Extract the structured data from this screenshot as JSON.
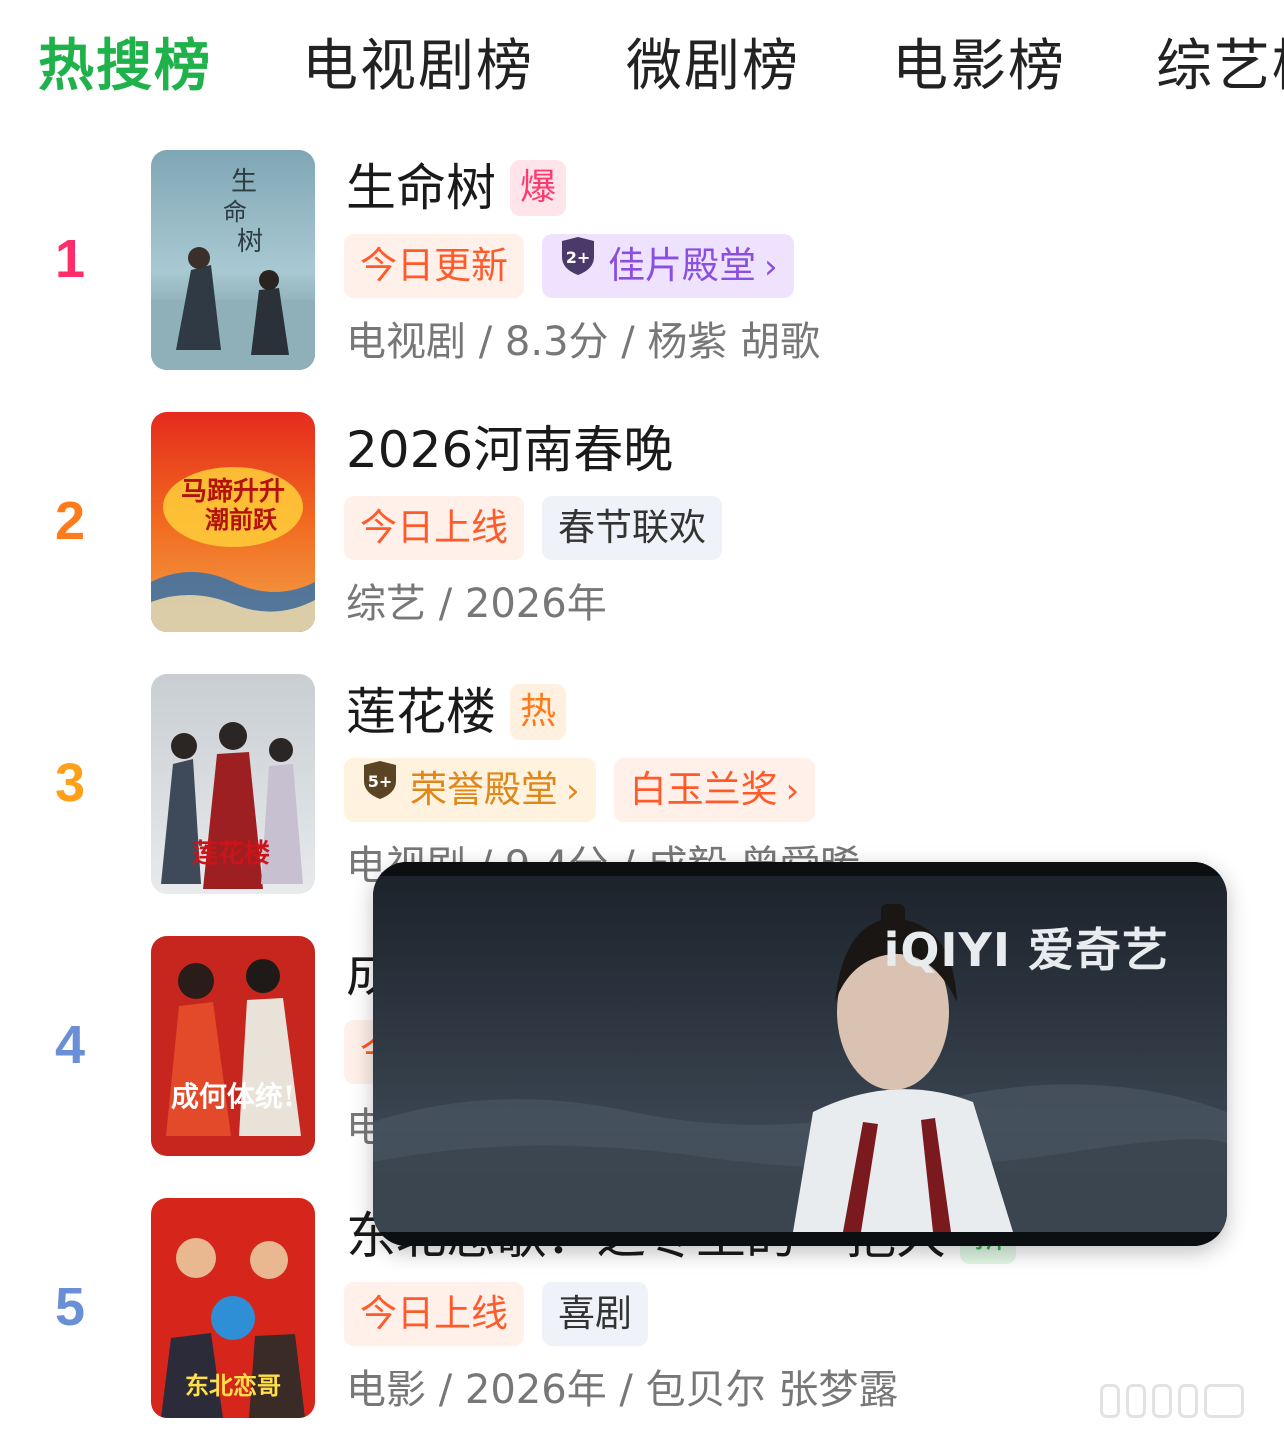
{
  "tabs": [
    {
      "label": "热搜榜",
      "active": true
    },
    {
      "label": "电视剧榜",
      "active": false
    },
    {
      "label": "微剧榜",
      "active": false
    },
    {
      "label": "电影榜",
      "active": false
    },
    {
      "label": "综艺榜",
      "active": false
    }
  ],
  "colors": {
    "accent_green": "#20b24a",
    "rank1": "#ff2d6a",
    "rank2": "#ff7a1a",
    "rank3": "#ff9f1a",
    "rank45": "#6b8fd6"
  },
  "items": [
    {
      "rank": "1",
      "title": "生命树",
      "badge": "爆",
      "tags": [
        "今日更新",
        "佳片殿堂"
      ],
      "tag_icon": "2+",
      "meta": "电视剧 / 8.3分 / 杨紫 胡歌"
    },
    {
      "rank": "2",
      "title": "2026河南春晚",
      "badge": "",
      "tags": [
        "今日上线",
        "春节联欢"
      ],
      "meta": "综艺 / 2026年"
    },
    {
      "rank": "3",
      "title": "莲花楼",
      "badge": "热",
      "tags": [
        "荣誉殿堂",
        "白玉兰奖"
      ],
      "tag_icon": "5+",
      "meta": "电视剧 / 9.4分 / 成毅 曾舜晞"
    },
    {
      "rank": "4",
      "title": "成",
      "badge": "",
      "tags": [
        "今"
      ],
      "meta": "电"
    },
    {
      "rank": "5",
      "title": "东北恋歌：之冬至的一抱大",
      "badge": "新",
      "tags": [
        "今日上线",
        "喜剧"
      ],
      "meta": "电影 / 2026年 / 包贝尔 张梦露"
    }
  ],
  "video": {
    "logo": "iQIYI 爱奇艺"
  }
}
